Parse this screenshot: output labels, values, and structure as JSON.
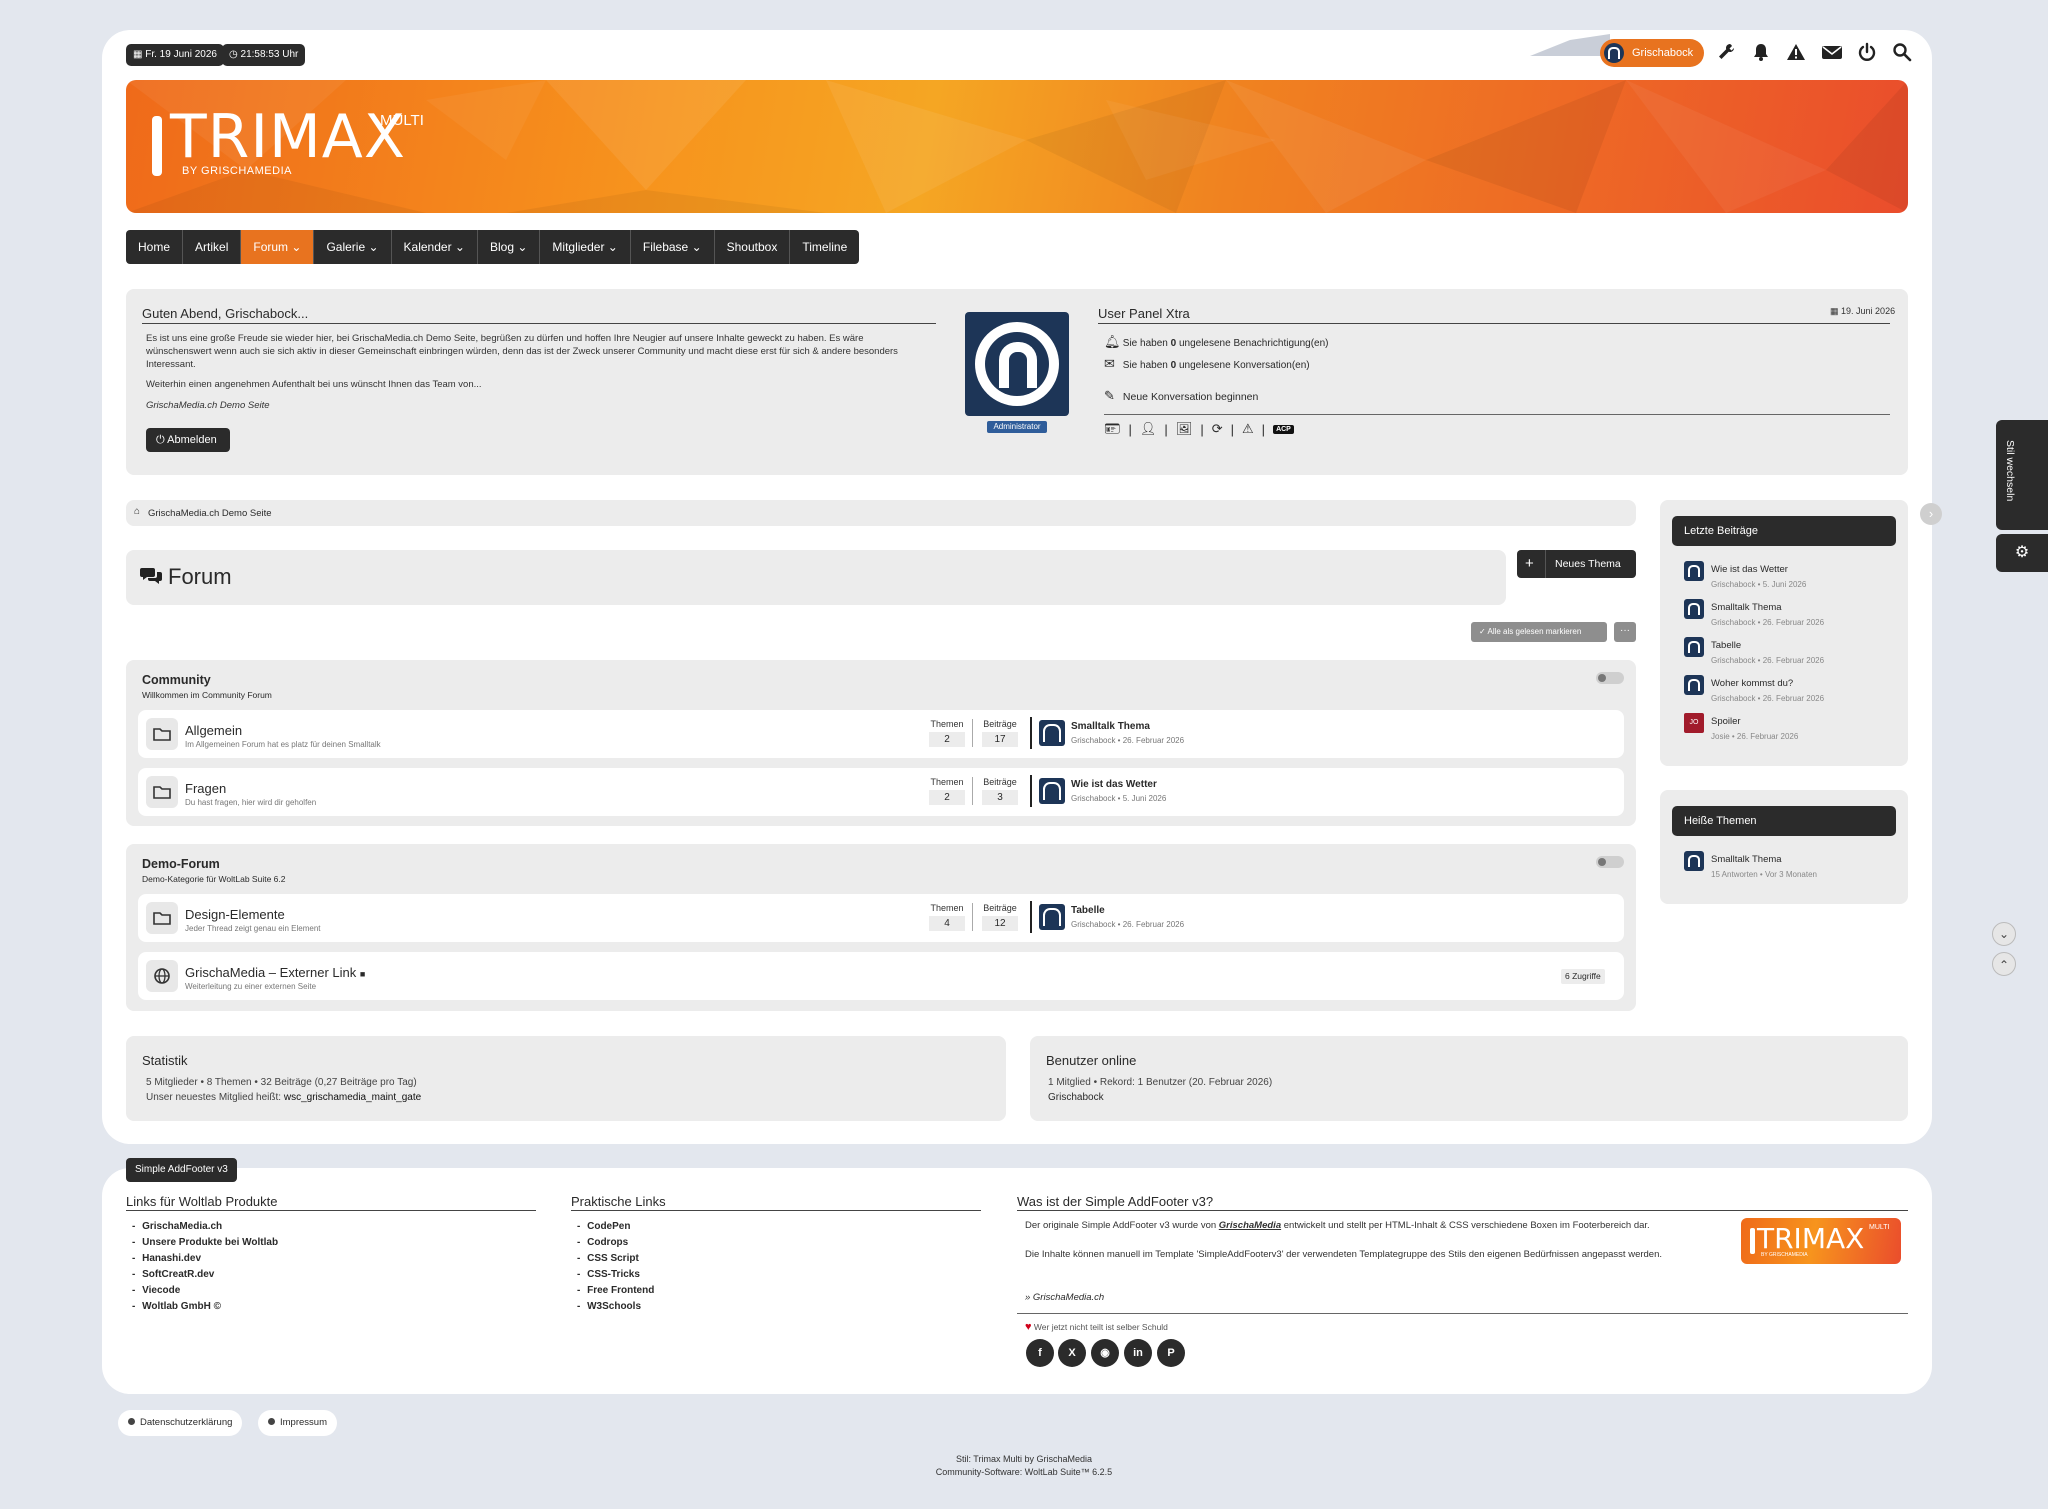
{
  "header": {
    "date": "Fr. 19 Juni 2026",
    "time": "21:58:53 Uhr",
    "user_button": "Grischabock",
    "logo_title": "TRIMAX",
    "logo_super": "MULTI",
    "logo_sub": "BY GRISCHAMEDIA",
    "accent": "#e8731f"
  },
  "nav": {
    "items": [
      "Home",
      "Artikel",
      "Forum",
      "Galerie",
      "Kalender",
      "Blog",
      "Mitglieder",
      "Filebase",
      "Shoutbox",
      "Timeline"
    ]
  },
  "welcome": {
    "title": "Guten Abend, Grischabock...",
    "p1": "Es ist uns eine große Freude sie wieder hier, bei GrischaMedia.ch Demo Seite, begrüßen zu dürfen und hoffen Ihre Neugier auf unsere Inhalte geweckt zu haben. Es wäre wünschenswert wenn auch sie sich aktiv in dieser Gemeinschaft einbringen würden, denn das ist der Zweck unserer Community und macht diese erst für sich & andere besonders Interessant.",
    "p2": "Weiterhin einen angenehmen Aufenthalt bei uns wünscht Ihnen das Team von...",
    "sig": "GrischaMedia.ch Demo Seite",
    "logout": "Abmelden",
    "badge": "Administrator"
  },
  "userpanel": {
    "title": "User Panel Xtra",
    "date": "19. Juni 2026",
    "notif_pre": "Sie haben",
    "notif_count": "0",
    "notif_post": "ungelesene Benachrichtigung(en)",
    "conv_pre": "Sie haben",
    "conv_count": "0",
    "conv_post": "ungelesene Konversation(en)",
    "new_conv": "Neue Konversation beginnen",
    "acp": "ACP"
  },
  "breadcrumb": "GrischaMedia.ch Demo Seite",
  "page": {
    "title": "Forum",
    "new_topic": "Neues Thema",
    "mark_read": "Alle als gelesen markieren"
  },
  "categories": [
    {
      "title": "Community",
      "desc": "Willkommen im Community Forum",
      "boards": [
        {
          "name": "Allgemein",
          "desc": "Im Allgemeinen Forum hat es platz für deinen Smalltalk",
          "topics_label": "Themen",
          "topics": "2",
          "posts_label": "Beiträge",
          "posts": "17",
          "last_title": "Smalltalk Thema",
          "last_meta": "Grischabock • 26. Februar 2026"
        },
        {
          "name": "Fragen",
          "desc": "Du hast fragen, hier wird dir geholfen",
          "topics_label": "Themen",
          "topics": "2",
          "posts_label": "Beiträge",
          "posts": "3",
          "last_title": "Wie ist das Wetter",
          "last_meta": "Grischabock • 5. Juni 2026"
        }
      ]
    },
    {
      "title": "Demo-Forum",
      "desc": "Demo-Kategorie für WoltLab Suite 6.2",
      "boards": [
        {
          "name": "Design-Elemente",
          "desc": "Jeder Thread zeigt genau ein Element",
          "topics_label": "Themen",
          "topics": "4",
          "posts_label": "Beiträge",
          "posts": "12",
          "last_title": "Tabelle",
          "last_meta": "Grischabock • 26. Februar 2026"
        }
      ],
      "external": {
        "name": "GrischaMedia – Externer Link",
        "desc": "Weiterleitung zu einer externen Seite",
        "hits": "6 Zugriffe"
      }
    }
  ],
  "stats": {
    "title": "Statistik",
    "line1": "5 Mitglieder • 8 Themen • 32 Beiträge (0,27 Beiträge pro Tag)",
    "line2_pre": "Unser neuestes Mitglied heißt:",
    "line2_user": "wsc_grischamedia_maint_gate"
  },
  "online": {
    "title": "Benutzer online",
    "line1": "1 Mitglied • Rekord: 1 Benutzer (20. Februar 2026)",
    "line2": "Grischabock"
  },
  "sidebar": {
    "latest_title": "Letzte Beiträge",
    "latest": [
      {
        "title": "Wie ist das Wetter",
        "meta": "Grischabock • 5. Juni 2026"
      },
      {
        "title": "Smalltalk Thema",
        "meta": "Grischabock • 26. Februar 2026"
      },
      {
        "title": "Tabelle",
        "meta": "Grischabock • 26. Februar 2026"
      },
      {
        "title": "Woher kommst du?",
        "meta": "Grischabock • 26. Februar 2026"
      },
      {
        "title": "Spoiler",
        "meta": "Josie • 26. Februar 2026",
        "initials": "JO"
      }
    ],
    "hot_title": "Heiße Themen",
    "hot": [
      {
        "title": "Smalltalk Thema",
        "meta": "15 Antworten • Vor 3 Monaten"
      }
    ],
    "style_switch": "Stil wechseln"
  },
  "footer": {
    "tag": "Simple AddFooter v3",
    "col1_title": "Links für Woltlab Produkte",
    "col1_links": [
      "GrischaMedia.ch",
      "Unsere Produkte bei Woltlab",
      "Hanashi.dev",
      "SoftCreatR.dev",
      "Viecode",
      "Woltlab GmbH ©"
    ],
    "col2_title": "Praktische Links",
    "col2_links": [
      "CodePen",
      "Codrops",
      "CSS Script",
      "CSS-Tricks",
      "Free Frontend",
      "W3Schools"
    ],
    "col3_title": "Was ist der Simple AddFooter v3?",
    "col3_p1_pre": "Der originale Simple AddFooter v3 wurde von",
    "col3_p1_brand": "GrischaMedia",
    "col3_p1_post": "entwickelt und stellt per HTML-Inhalt & CSS verschiedene Boxen im Footerbereich dar.",
    "col3_p2": "Die Inhalte können manuell im Template 'SimpleAddFooterv3' der verwendeten Templategruppe des Stils den eigenen Bedürfnissen angepasst werden.",
    "col3_link": "» GrischaMedia.ch",
    "share_text": "Wer jetzt nicht teilt ist selber Schuld",
    "legal": [
      "Datenschutzerklärung",
      "Impressum"
    ],
    "credit1": "Stil: Trimax Multi by GrischaMedia",
    "credit2": "Community-Software: WoltLab Suite™ 6.2.5"
  }
}
